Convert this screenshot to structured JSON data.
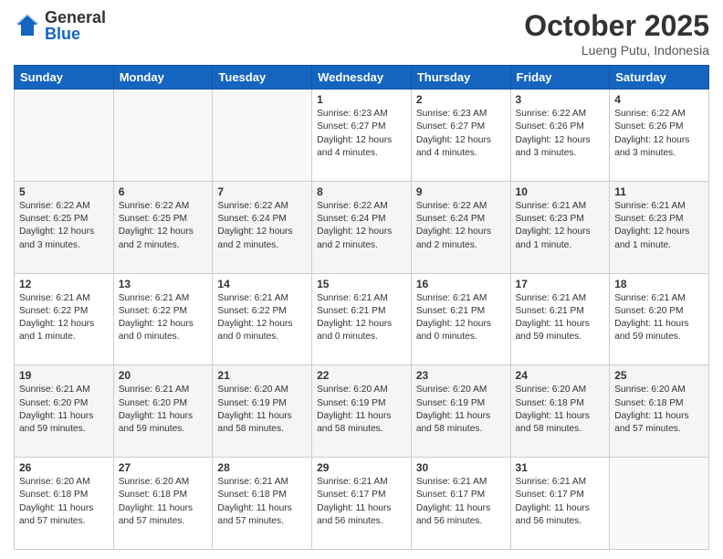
{
  "header": {
    "logo_general": "General",
    "logo_blue": "Blue",
    "month": "October 2025",
    "location": "Lueng Putu, Indonesia"
  },
  "days_of_week": [
    "Sunday",
    "Monday",
    "Tuesday",
    "Wednesday",
    "Thursday",
    "Friday",
    "Saturday"
  ],
  "weeks": [
    [
      {
        "day": "",
        "sunrise": "",
        "sunset": "",
        "daylight": ""
      },
      {
        "day": "",
        "sunrise": "",
        "sunset": "",
        "daylight": ""
      },
      {
        "day": "",
        "sunrise": "",
        "sunset": "",
        "daylight": ""
      },
      {
        "day": "1",
        "sunrise": "6:23 AM",
        "sunset": "6:27 PM",
        "daylight": "12 hours and 4 minutes."
      },
      {
        "day": "2",
        "sunrise": "6:23 AM",
        "sunset": "6:27 PM",
        "daylight": "12 hours and 4 minutes."
      },
      {
        "day": "3",
        "sunrise": "6:22 AM",
        "sunset": "6:26 PM",
        "daylight": "12 hours and 3 minutes."
      },
      {
        "day": "4",
        "sunrise": "6:22 AM",
        "sunset": "6:26 PM",
        "daylight": "12 hours and 3 minutes."
      }
    ],
    [
      {
        "day": "5",
        "sunrise": "6:22 AM",
        "sunset": "6:25 PM",
        "daylight": "12 hours and 3 minutes."
      },
      {
        "day": "6",
        "sunrise": "6:22 AM",
        "sunset": "6:25 PM",
        "daylight": "12 hours and 2 minutes."
      },
      {
        "day": "7",
        "sunrise": "6:22 AM",
        "sunset": "6:24 PM",
        "daylight": "12 hours and 2 minutes."
      },
      {
        "day": "8",
        "sunrise": "6:22 AM",
        "sunset": "6:24 PM",
        "daylight": "12 hours and 2 minutes."
      },
      {
        "day": "9",
        "sunrise": "6:22 AM",
        "sunset": "6:24 PM",
        "daylight": "12 hours and 2 minutes."
      },
      {
        "day": "10",
        "sunrise": "6:21 AM",
        "sunset": "6:23 PM",
        "daylight": "12 hours and 1 minute."
      },
      {
        "day": "11",
        "sunrise": "6:21 AM",
        "sunset": "6:23 PM",
        "daylight": "12 hours and 1 minute."
      }
    ],
    [
      {
        "day": "12",
        "sunrise": "6:21 AM",
        "sunset": "6:22 PM",
        "daylight": "12 hours and 1 minute."
      },
      {
        "day": "13",
        "sunrise": "6:21 AM",
        "sunset": "6:22 PM",
        "daylight": "12 hours and 0 minutes."
      },
      {
        "day": "14",
        "sunrise": "6:21 AM",
        "sunset": "6:22 PM",
        "daylight": "12 hours and 0 minutes."
      },
      {
        "day": "15",
        "sunrise": "6:21 AM",
        "sunset": "6:21 PM",
        "daylight": "12 hours and 0 minutes."
      },
      {
        "day": "16",
        "sunrise": "6:21 AM",
        "sunset": "6:21 PM",
        "daylight": "12 hours and 0 minutes."
      },
      {
        "day": "17",
        "sunrise": "6:21 AM",
        "sunset": "6:21 PM",
        "daylight": "11 hours and 59 minutes."
      },
      {
        "day": "18",
        "sunrise": "6:21 AM",
        "sunset": "6:20 PM",
        "daylight": "11 hours and 59 minutes."
      }
    ],
    [
      {
        "day": "19",
        "sunrise": "6:21 AM",
        "sunset": "6:20 PM",
        "daylight": "11 hours and 59 minutes."
      },
      {
        "day": "20",
        "sunrise": "6:21 AM",
        "sunset": "6:20 PM",
        "daylight": "11 hours and 59 minutes."
      },
      {
        "day": "21",
        "sunrise": "6:20 AM",
        "sunset": "6:19 PM",
        "daylight": "11 hours and 58 minutes."
      },
      {
        "day": "22",
        "sunrise": "6:20 AM",
        "sunset": "6:19 PM",
        "daylight": "11 hours and 58 minutes."
      },
      {
        "day": "23",
        "sunrise": "6:20 AM",
        "sunset": "6:19 PM",
        "daylight": "11 hours and 58 minutes."
      },
      {
        "day": "24",
        "sunrise": "6:20 AM",
        "sunset": "6:18 PM",
        "daylight": "11 hours and 58 minutes."
      },
      {
        "day": "25",
        "sunrise": "6:20 AM",
        "sunset": "6:18 PM",
        "daylight": "11 hours and 57 minutes."
      }
    ],
    [
      {
        "day": "26",
        "sunrise": "6:20 AM",
        "sunset": "6:18 PM",
        "daylight": "11 hours and 57 minutes."
      },
      {
        "day": "27",
        "sunrise": "6:20 AM",
        "sunset": "6:18 PM",
        "daylight": "11 hours and 57 minutes."
      },
      {
        "day": "28",
        "sunrise": "6:21 AM",
        "sunset": "6:18 PM",
        "daylight": "11 hours and 57 minutes."
      },
      {
        "day": "29",
        "sunrise": "6:21 AM",
        "sunset": "6:17 PM",
        "daylight": "11 hours and 56 minutes."
      },
      {
        "day": "30",
        "sunrise": "6:21 AM",
        "sunset": "6:17 PM",
        "daylight": "11 hours and 56 minutes."
      },
      {
        "day": "31",
        "sunrise": "6:21 AM",
        "sunset": "6:17 PM",
        "daylight": "11 hours and 56 minutes."
      },
      {
        "day": "",
        "sunrise": "",
        "sunset": "",
        "daylight": ""
      }
    ]
  ]
}
